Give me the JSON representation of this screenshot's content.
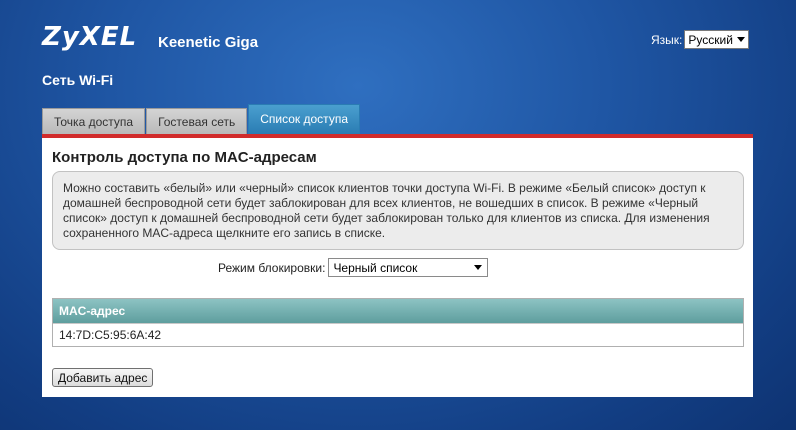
{
  "header": {
    "logo": "ZyXEL",
    "model": "Keenetic Giga",
    "language_label": "Язык:",
    "language_value": "Русский"
  },
  "section_title": "Сеть Wi-Fi",
  "tabs": [
    {
      "label": "Точка доступа",
      "active": false
    },
    {
      "label": "Гостевая сеть",
      "active": false
    },
    {
      "label": "Список доступа",
      "active": true
    }
  ],
  "panel": {
    "title": "Контроль доступа по MAC-адресам",
    "info": "Можно составить «белый» или «черный» список клиентов точки доступа Wi-Fi. В режиме «Белый список» доступ к домашней беспроводной сети будет заблокирован для всех клиентов, не вошедших в список. В режиме «Черный список» доступ к домашней беспроводной сети будет заблокирован только для клиентов из списка. Для изменения сохраненного MAC-адреса щелкните его запись в списке.",
    "mode_label": "Режим блокировки:",
    "mode_value": "Черный список",
    "table_header": "MAC-адрес",
    "rows": [
      "14:7D:C5:95:6A:42"
    ],
    "add_button": "Добавить адрес"
  },
  "colors": {
    "background": "#1f56a4",
    "tab_active": "#2a7cb3",
    "accent_line": "#d12b2b",
    "table_header": "#6aa8a8"
  }
}
